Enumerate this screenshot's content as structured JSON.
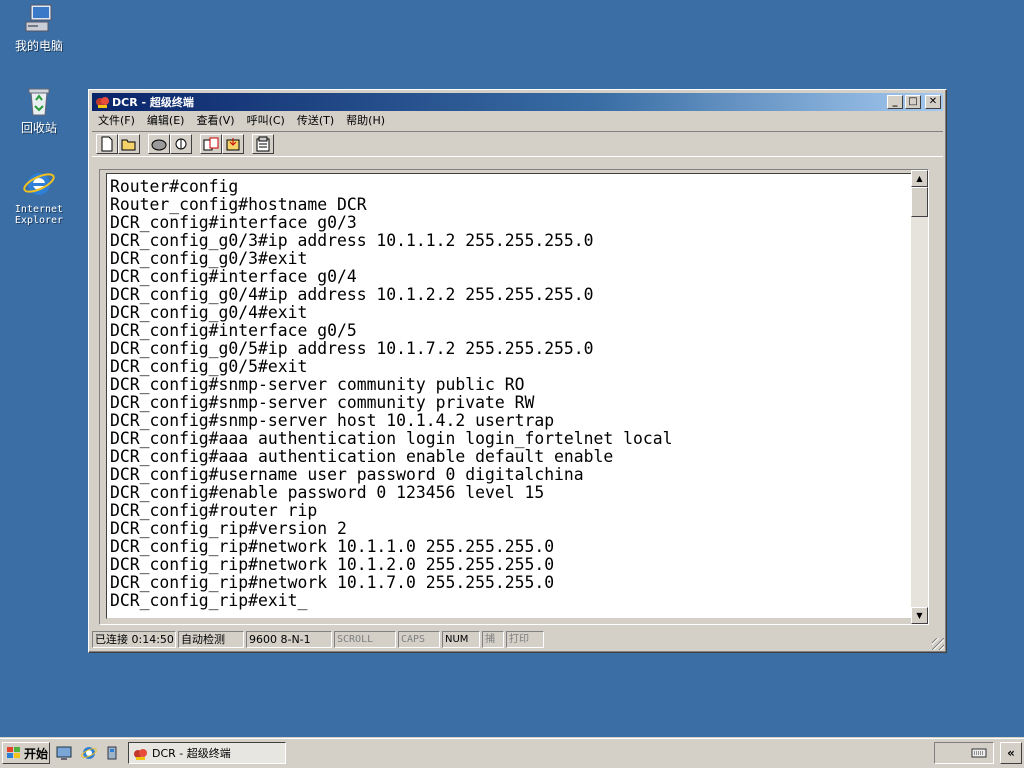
{
  "desktop": {
    "icons": [
      {
        "label": "我的电脑",
        "icon": "my-computer-icon"
      },
      {
        "label": "回收站",
        "icon": "recycle-bin-icon"
      },
      {
        "label": "Internet\nExplorer",
        "icon": "internet-explorer-icon"
      }
    ]
  },
  "window": {
    "title": "DCR - 超级终端",
    "controls": {
      "minimize": "_",
      "maximize": "□",
      "close": "✕"
    },
    "menu": [
      "文件(F)",
      "编辑(E)",
      "查看(V)",
      "呼叫(C)",
      "传送(T)",
      "帮助(H)"
    ],
    "toolbar": [
      {
        "icon": "new-icon"
      },
      {
        "icon": "open-icon"
      },
      {
        "icon": "call-icon"
      },
      {
        "icon": "disconnect-icon"
      },
      {
        "icon": "send-icon"
      },
      {
        "icon": "receive-icon"
      },
      {
        "icon": "properties-icon"
      }
    ],
    "terminal_lines": [
      "Router#config",
      "Router_config#hostname DCR",
      "DCR_config#interface g0/3",
      "DCR_config_g0/3#ip address 10.1.1.2 255.255.255.0",
      "DCR_config_g0/3#exit",
      "DCR_config#interface g0/4",
      "DCR_config_g0/4#ip address 10.1.2.2 255.255.255.0",
      "DCR_config_g0/4#exit",
      "DCR_config#interface g0/5",
      "DCR_config_g0/5#ip address 10.1.7.2 255.255.255.0",
      "DCR_config_g0/5#exit",
      "DCR_config#snmp-server community public RO",
      "DCR_config#snmp-server community private RW",
      "DCR_config#snmp-server host 10.1.4.2 usertrap",
      "DCR_config#aaa authentication login login_fortelnet local",
      "DCR_config#aaa authentication enable default enable",
      "DCR_config#username user password 0 digitalchina",
      "DCR_config#enable password 0 123456 level 15",
      "DCR_config#router rip",
      "DCR_config_rip#version 2",
      "DCR_config_rip#network 10.1.1.0 255.255.255.0",
      "DCR_config_rip#network 10.1.2.0 255.255.255.0",
      "DCR_config_rip#network 10.1.7.0 255.255.255.0",
      "DCR_config_rip#exit_"
    ],
    "status": {
      "connected": "已连接 0:14:50",
      "detect": "自动检测",
      "baud": "9600 8-N-1",
      "scroll": "SCROLL",
      "caps": "CAPS",
      "num": "NUM",
      "capture": "捕",
      "print": "打印"
    }
  },
  "taskbar": {
    "start_label": "开始",
    "task_title": "DCR - 超级终端",
    "tray_icon": "keyboard-icon",
    "tray_toggle": "«"
  }
}
